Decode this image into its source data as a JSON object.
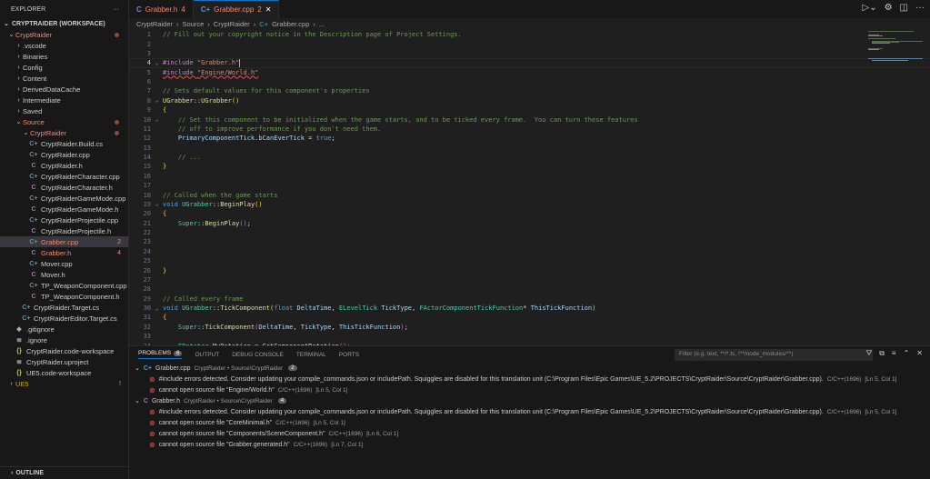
{
  "sidebar": {
    "title": "EXPLORER",
    "more": "···",
    "workspace": "CRYPTRAIDER (WORKSPACE)",
    "outline": "OUTLINE",
    "items": [
      {
        "label": "CryptRaider",
        "depth": 0,
        "type": "folder-open",
        "cls": "err",
        "dot": true
      },
      {
        "label": ".vscode",
        "depth": 1,
        "type": "folder"
      },
      {
        "label": "Binaries",
        "depth": 1,
        "type": "folder"
      },
      {
        "label": "Config",
        "depth": 1,
        "type": "folder"
      },
      {
        "label": "Content",
        "depth": 1,
        "type": "folder"
      },
      {
        "label": "DerivedDataCache",
        "depth": 1,
        "type": "folder"
      },
      {
        "label": "Intermediate",
        "depth": 1,
        "type": "folder"
      },
      {
        "label": "Saved",
        "depth": 1,
        "type": "folder"
      },
      {
        "label": "Source",
        "depth": 1,
        "type": "folder-open",
        "cls": "err",
        "dot": true
      },
      {
        "label": "CryptRaider",
        "depth": 2,
        "type": "folder-open",
        "cls": "err",
        "dot": true
      },
      {
        "label": "CryptRaider.Build.cs",
        "depth": 3,
        "type": "cpp"
      },
      {
        "label": "CryptRaider.cpp",
        "depth": 3,
        "type": "cpp"
      },
      {
        "label": "CryptRaider.h",
        "depth": 3,
        "type": "h"
      },
      {
        "label": "CryptRaiderCharacter.cpp",
        "depth": 3,
        "type": "cpp"
      },
      {
        "label": "CryptRaiderCharacter.h",
        "depth": 3,
        "type": "h"
      },
      {
        "label": "CryptRaiderGameMode.cpp",
        "depth": 3,
        "type": "cpp"
      },
      {
        "label": "CryptRaiderGameMode.h",
        "depth": 3,
        "type": "h"
      },
      {
        "label": "CryptRaiderProjectile.cpp",
        "depth": 3,
        "type": "cpp"
      },
      {
        "label": "CryptRaiderProjectile.h",
        "depth": 3,
        "type": "h"
      },
      {
        "label": "Grabber.cpp",
        "depth": 3,
        "type": "cpp",
        "cls": "err",
        "badge": "2",
        "selected": true
      },
      {
        "label": "Grabber.h",
        "depth": 3,
        "type": "h",
        "cls": "err",
        "badge": "4"
      },
      {
        "label": "Mover.cpp",
        "depth": 3,
        "type": "cpp"
      },
      {
        "label": "Mover.h",
        "depth": 3,
        "type": "h"
      },
      {
        "label": "TP_WeaponComponent.cpp",
        "depth": 3,
        "type": "cpp"
      },
      {
        "label": "TP_WeaponComponent.h",
        "depth": 3,
        "type": "h"
      },
      {
        "label": "CryptRaider.Target.cs",
        "depth": 2,
        "type": "cpp"
      },
      {
        "label": "CryptRaiderEditor.Target.cs",
        "depth": 2,
        "type": "cpp"
      },
      {
        "label": ".gitignore",
        "depth": 1,
        "type": "git"
      },
      {
        "label": ".ignore",
        "depth": 1,
        "type": "file"
      },
      {
        "label": "CryptRaider.code-workspace",
        "depth": 1,
        "type": "json"
      },
      {
        "label": "CryptRaider.uproject",
        "depth": 1,
        "type": "file"
      },
      {
        "label": "UE5.code-workspace",
        "depth": 1,
        "type": "json"
      },
      {
        "label": "UE5",
        "depth": 0,
        "type": "folder",
        "cls": "warn",
        "badge": "!",
        "badgecls": "warn"
      }
    ]
  },
  "tabs": [
    {
      "label": "Grabber.h",
      "badge": "4",
      "icon": "C",
      "active": false
    },
    {
      "label": "Grabber.cpp",
      "badge": "2",
      "icon": "C+",
      "active": true,
      "close": "✕"
    }
  ],
  "breadcrumb": [
    "CryptRaider",
    "Source",
    "CryptRaider",
    "Grabber.cpp",
    "..."
  ],
  "editor": {
    "current_line": 4,
    "lines": [
      [
        [
          "cm",
          "// Fill out your copyright notice in the Description page of Project Settings."
        ]
      ],
      [],
      [],
      [
        [
          "pp",
          "#include "
        ],
        [
          "str",
          "\"Grabber.h\""
        ]
      ],
      [
        [
          "pp t-sq",
          "#include "
        ],
        [
          "str t-sq",
          "\"Engine/World.h\""
        ]
      ],
      [],
      [
        [
          "cm",
          "// Sets default values for this component's properties"
        ]
      ],
      [
        [
          "fn",
          "UGrabber"
        ],
        [
          "pl",
          "::"
        ],
        [
          "fn",
          "UGrabber"
        ],
        [
          "br",
          "()"
        ]
      ],
      [
        [
          "br",
          "{"
        ]
      ],
      [
        [
          "pl",
          "    "
        ],
        [
          "cm",
          "// Set this component to be initialized when the game starts, and to be ticked every frame.  You can turn these features"
        ]
      ],
      [
        [
          "pl",
          "    "
        ],
        [
          "cm",
          "// off to improve performance if you don't need them."
        ]
      ],
      [
        [
          "pl",
          "    "
        ],
        [
          "var",
          "PrimaryComponentTick"
        ],
        [
          "pl",
          "."
        ],
        [
          "var",
          "bCanEverTick"
        ],
        [
          "pl",
          " = "
        ],
        [
          "kw",
          "true"
        ],
        [
          "pl",
          ";"
        ]
      ],
      [],
      [
        [
          "pl",
          "    "
        ],
        [
          "cm",
          "// ..."
        ]
      ],
      [
        [
          "br",
          "}"
        ]
      ],
      [],
      [],
      [
        [
          "cm",
          "// Called when the game starts"
        ]
      ],
      [
        [
          "kw",
          "void "
        ],
        [
          "ty",
          "UGrabber"
        ],
        [
          "pl",
          "::"
        ],
        [
          "fn",
          "BeginPlay"
        ],
        [
          "br",
          "()"
        ]
      ],
      [
        [
          "br",
          "{"
        ]
      ],
      [
        [
          "pl",
          "    "
        ],
        [
          "ty",
          "Super"
        ],
        [
          "pl",
          "::"
        ],
        [
          "fn",
          "BeginPlay"
        ],
        [
          "br2",
          "()"
        ],
        [
          "pl",
          ";"
        ]
      ],
      [],
      [],
      [],
      [],
      [
        [
          "br",
          "}"
        ]
      ],
      [],
      [],
      [
        [
          "cm",
          "// Called every frame"
        ]
      ],
      [
        [
          "kw",
          "void "
        ],
        [
          "ty",
          "UGrabber"
        ],
        [
          "pl",
          "::"
        ],
        [
          "fn",
          "TickComponent"
        ],
        [
          "br",
          "("
        ],
        [
          "kw",
          "float "
        ],
        [
          "var",
          "DeltaTime"
        ],
        [
          "pl",
          ", "
        ],
        [
          "ty",
          "ELevelTick "
        ],
        [
          "var",
          "TickType"
        ],
        [
          "pl",
          ", "
        ],
        [
          "ty",
          "FActorComponentTickFunction"
        ],
        [
          "pl",
          "* "
        ],
        [
          "var",
          "ThisTickFunction"
        ],
        [
          "br",
          ")"
        ]
      ],
      [
        [
          "br",
          "{"
        ]
      ],
      [
        [
          "pl",
          "    "
        ],
        [
          "ty",
          "Super"
        ],
        [
          "pl",
          "::"
        ],
        [
          "fn",
          "TickComponent"
        ],
        [
          "br2",
          "("
        ],
        [
          "var",
          "DeltaTime"
        ],
        [
          "pl",
          ", "
        ],
        [
          "var",
          "TickType"
        ],
        [
          "pl",
          ", "
        ],
        [
          "var",
          "ThisTickFunction"
        ],
        [
          "br2",
          ")"
        ],
        [
          "pl",
          ";"
        ]
      ],
      [],
      [
        [
          "pl",
          "    "
        ],
        [
          "ty",
          "FRotator "
        ],
        [
          "var",
          "MyRotation"
        ],
        [
          "pl",
          " = "
        ],
        [
          "fn",
          "GetComponentRotation"
        ],
        [
          "br2",
          "()"
        ],
        [
          "pl",
          ";"
        ]
      ]
    ],
    "folds": [
      4,
      8,
      10,
      19,
      30
    ]
  },
  "panel": {
    "tabs": [
      {
        "label": "PROBLEMS",
        "count": "6",
        "active": true
      },
      {
        "label": "OUTPUT"
      },
      {
        "label": "DEBUG CONSOLE"
      },
      {
        "label": "TERMINAL"
      },
      {
        "label": "PORTS"
      }
    ],
    "filter_placeholder": "Filter (e.g. text, **/*.ts, !**/node_modules/**)",
    "groups": [
      {
        "file": "Grabber.cpp",
        "icon": "C+",
        "path": "CryptRaider • Source\\CryptRaider",
        "count": "2",
        "problems": [
          {
            "msg": "#include errors detected. Consider updating your compile_commands.json or includePath. Squiggles are disabled for this translation unit (C:\\Program Files\\Epic Games\\UE_5.2\\PROJECTS\\CryptRaider\\Source\\CryptRaider\\Grabber.cpp).",
            "src": "C/C++(1696)",
            "loc": "[Ln 5, Col 1]"
          },
          {
            "msg": "cannot open source file \"Engine/World.h\"",
            "src": "C/C++(1696)",
            "loc": "[Ln 5, Col 1]"
          }
        ]
      },
      {
        "file": "Grabber.h",
        "icon": "C",
        "path": "CryptRaider • Source\\CryptRaider",
        "count": "4",
        "problems": [
          {
            "msg": "#include errors detected. Consider updating your compile_commands.json or includePath. Squiggles are disabled for this translation unit (C:\\Program Files\\Epic Games\\UE_5.2\\PROJECTS\\CryptRaider\\Source\\CryptRaider\\Grabber.cpp).",
            "src": "C/C++(1696)",
            "loc": "[Ln 5, Col 1]"
          },
          {
            "msg": "cannot open source file \"CoreMinimal.h\"",
            "src": "C/C++(1696)",
            "loc": "[Ln 5, Col 1]"
          },
          {
            "msg": "cannot open source file \"Components/SceneComponent.h\"",
            "src": "C/C++(1696)",
            "loc": "[Ln 6, Col 1]"
          },
          {
            "msg": "cannot open source file \"Grabber.generated.h\"",
            "src": "C/C++(1696)",
            "loc": "[Ln 7, Col 1]"
          }
        ]
      }
    ]
  }
}
